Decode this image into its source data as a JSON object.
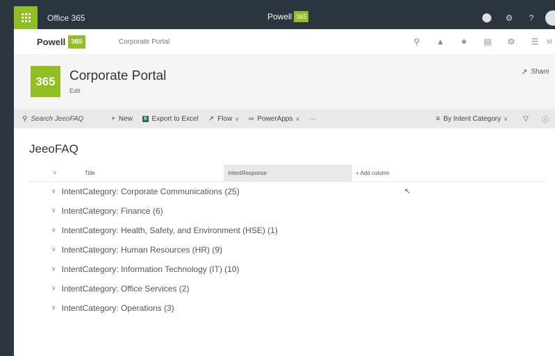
{
  "suite_bar": {
    "app_title": "Office 365",
    "brand_name": "Powell",
    "brand_badge": "365",
    "icons": [
      "bell-icon",
      "gear-icon",
      "help-icon",
      "avatar"
    ],
    "help_glyph": "?"
  },
  "header_bar": {
    "brand_name": "Powell",
    "brand_badge": "365",
    "site_link": "Corporate Portal",
    "icons": [
      "search-icon",
      "notification-icon",
      "favorite-icon",
      "document-icon",
      "settings-icon",
      "menu-icon"
    ],
    "more_label": "M"
  },
  "site_header": {
    "logo_text": "365",
    "title": "Corporate Portal",
    "edit_label": "Edit",
    "share_label": "Share"
  },
  "command_bar": {
    "search_placeholder": "Search JeeoFAQ",
    "new_label": "New",
    "export_label": "Export to Excel",
    "export_icon_text": "X",
    "flow_label": "Flow",
    "powerapps_label": "PowerApps",
    "more_glyph": "···",
    "view_label": "By Intent Category"
  },
  "list": {
    "title": "JeeoFAQ",
    "columns": {
      "title": "Title",
      "intent_response": "IntentResponse",
      "add_column": "+ Add column"
    },
    "groups": [
      "IntentCategory: Corporate Communications (25)",
      "IntentCategory: Finance (6)",
      "IntentCategory: Health, Safety, and Environment (HSE) (1)",
      "IntentCategory: Human Resources (HR) (9)",
      "IntentCategory: Information Technology (IT) (10)",
      "IntentCategory: Office Services (2)",
      "IntentCategory: Operations (3)"
    ]
  },
  "colors": {
    "brand_green": "#8fbf20",
    "suite_bar": "#2a3540",
    "command_bar": "#ebe8e9"
  }
}
